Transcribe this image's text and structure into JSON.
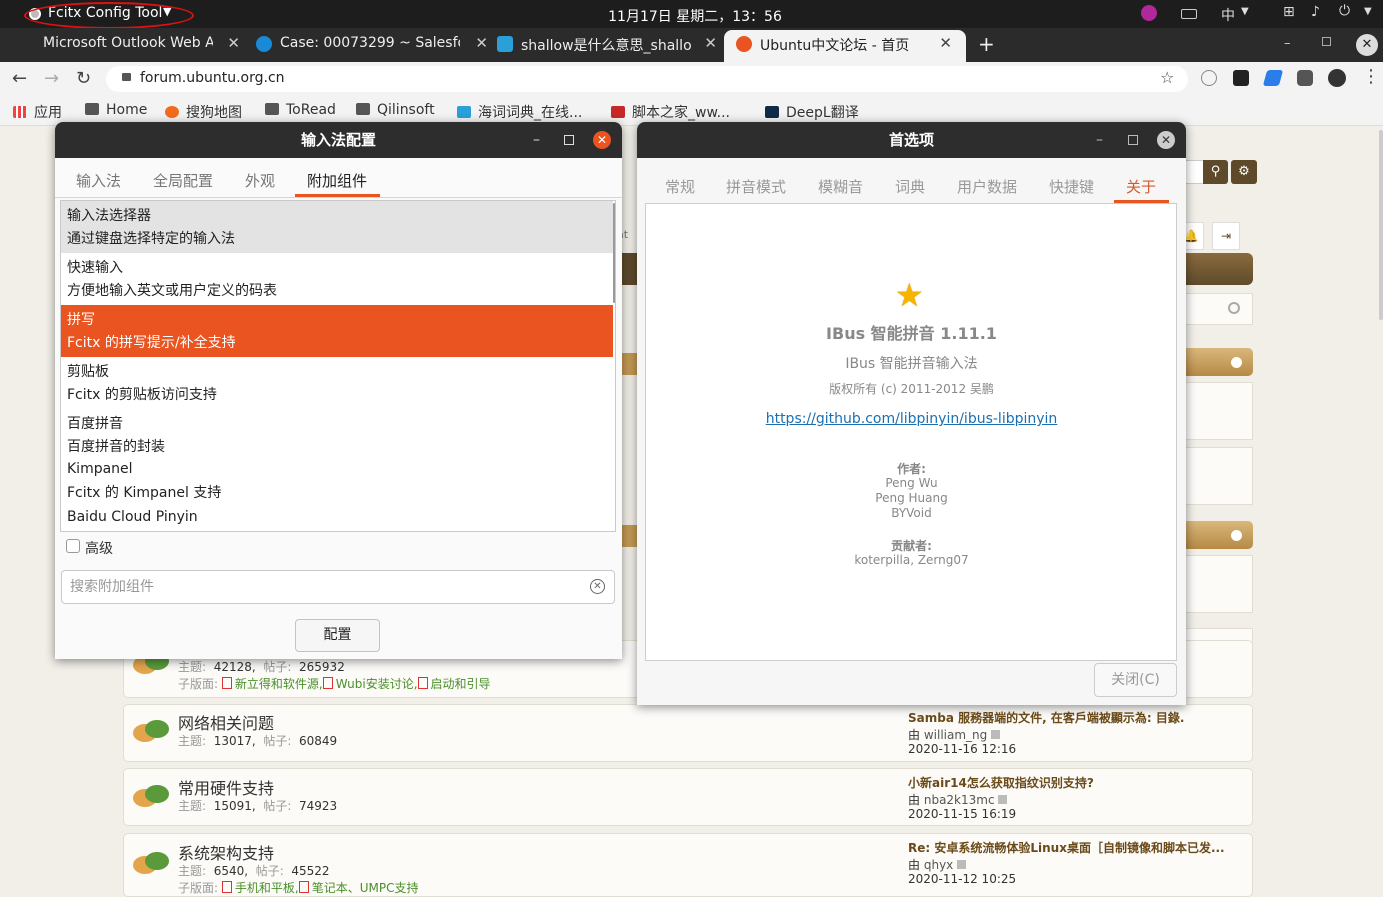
{
  "topbar": {
    "app_menu_label": "Fcitx Config Tool",
    "clock": "11月17日 星期二，13：56",
    "input_method_indicator": "中"
  },
  "browser": {
    "tabs": [
      {
        "label": "Microsoft Outlook Web A",
        "icon": "outlook-icon"
      },
      {
        "label": "Case: 00073299 ~ Salesfor",
        "icon": "salesforce-cloud-icon"
      },
      {
        "label": "shallow是什么意思_shallo",
        "icon": "dict-d-icon"
      },
      {
        "label": "Ubuntu中文论坛 - 首页",
        "icon": "ubuntu-icon",
        "active": true
      }
    ],
    "url": "forum.ubuntu.org.cn",
    "bookmarks": [
      {
        "label": "应用",
        "icon": "apps-grid-icon"
      },
      {
        "label": "Home",
        "icon": "folder-icon"
      },
      {
        "label": "搜狗地图",
        "icon": "sogou-icon"
      },
      {
        "label": "ToRead",
        "icon": "folder-icon"
      },
      {
        "label": "Qilinsoft",
        "icon": "folder-icon"
      },
      {
        "label": "海词词典_在线...",
        "icon": "dict-d-icon"
      },
      {
        "label": "脚本之家_ww...",
        "icon": "jb51-icon"
      },
      {
        "label": "DeepL翻译",
        "icon": "deepl-icon"
      }
    ]
  },
  "forum": {
    "partial_text": "at",
    "rows": [
      {
        "title": "",
        "topics_label": "主题:",
        "topics": "42128,",
        "posts_label": "帖子:",
        "posts": "265932",
        "sub_label": "子版面:",
        "subforums": [
          "新立得和软件源,",
          "Wubi安装讨论,",
          "启动和引导"
        ],
        "last_title": "",
        "last_by_prefix": "",
        "last_user": "",
        "last_date": ""
      },
      {
        "title": "网络相关问题",
        "topics_label": "主题:",
        "topics": "13017,",
        "posts_label": "帖子:",
        "posts": "60849",
        "last_title": "Samba 服務器端的文件, 在客戶端被顯示為: 目錄.",
        "last_by_prefix": "由",
        "last_user": "william_ng",
        "last_date": "2020-11-16 12:16"
      },
      {
        "title": "常用硬件支持",
        "topics_label": "主题:",
        "topics": "15091,",
        "posts_label": "帖子:",
        "posts": "74923",
        "last_title": "小新air14怎么获取指纹识别支持?",
        "last_by_prefix": "由",
        "last_user": "nba2k13mc",
        "last_date": "2020-11-15 16:19"
      },
      {
        "title": "系统架构支持",
        "topics_label": "主题:",
        "topics": "6540,",
        "posts_label": "帖子:",
        "posts": "45522",
        "sub_label": "子版面:",
        "subforums": [
          "手机和平板,",
          "笔记本、UMPC支持"
        ],
        "last_title": "Re: 安卓系统流畅体验Linux桌面［自制镜像和脚本已发...",
        "last_by_prefix": "由",
        "last_user": "qhyx",
        "last_date": "2020-11-12 10:25"
      }
    ]
  },
  "fcitx_dialog": {
    "title": "输入法配置",
    "tabs": [
      "输入法",
      "全局配置",
      "外观",
      "附加组件"
    ],
    "active_tab": "附加组件",
    "addons": [
      {
        "name": "输入法选择器",
        "desc": "通过键盘选择特定的输入法",
        "state": "hover"
      },
      {
        "name": "快速输入",
        "desc": "方便地输入英文或用户定义的码表",
        "state": "normal"
      },
      {
        "name": "拼写",
        "desc": "Fcitx 的拼写提示/补全支持",
        "state": "selected"
      },
      {
        "name": "剪贴板",
        "desc": "Fcitx 的剪贴板访问支持",
        "state": "normal"
      },
      {
        "name": "百度拼音",
        "desc": "百度拼音的封装",
        "state": "normal"
      },
      {
        "name": "Kimpanel",
        "desc": "Fcitx 的 Kimpanel 支持",
        "state": "normal"
      },
      {
        "name": "Baidu Cloud Pinyin",
        "desc": "",
        "state": "normal"
      }
    ],
    "advanced_label": "高级",
    "advanced_checked": false,
    "search_placeholder": "搜索附加组件",
    "config_button": "配置"
  },
  "prefs_dialog": {
    "title": "首选项",
    "tabs": [
      "常规",
      "拼音模式",
      "模糊音",
      "词典",
      "用户数据",
      "快捷键",
      "关于"
    ],
    "active_tab": "关于",
    "app_name": "IBus 智能拼音 1.11.1",
    "app_desc": "IBus 智能拼音输入法",
    "copyright": "版权所有 (c) 2011-2012 吴鹏",
    "link": "https://github.com/libpinyin/ibus-libpinyin",
    "authors_heading": "作者:",
    "authors": [
      "Peng Wu",
      "Peng Huang",
      "BYVoid"
    ],
    "contributors_heading": "贡献者:",
    "contributors": "koterpilla, Zerng07",
    "close_button": "关闭(C)"
  },
  "colors": {
    "ubuntu_orange": "#e95420",
    "panel_dark": "#1d1d1d",
    "link_blue": "#1a6fb3"
  }
}
